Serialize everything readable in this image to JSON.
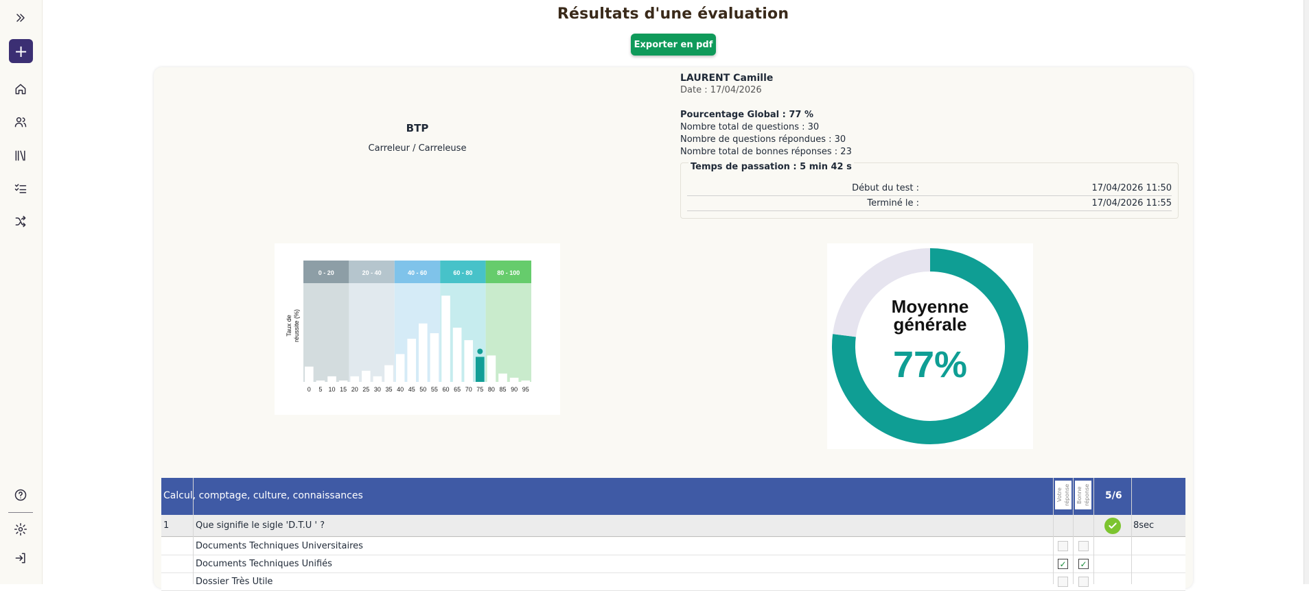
{
  "sidebar": {
    "items": [
      {
        "icon": "expand-chevrons-icon"
      },
      {
        "icon": "plus-icon"
      },
      {
        "icon": "home-icon"
      },
      {
        "icon": "users-icon"
      },
      {
        "icon": "library-icon"
      },
      {
        "icon": "checklist-icon"
      },
      {
        "icon": "shuffle-icon"
      },
      {
        "icon": "help-icon"
      },
      {
        "icon": "settings-icon"
      },
      {
        "icon": "logout-icon"
      }
    ]
  },
  "header": {
    "title": "Résultats d'une évaluation",
    "export_label": "Exporter en pdf"
  },
  "evaluation": {
    "domain": "BTP",
    "job": "Carreleur / Carreleuse"
  },
  "candidate": {
    "name": "LAURENT Camille",
    "date": "Date : 17/04/2026",
    "global_pct": "Pourcentage Global : 77 %",
    "total_questions": "Nombre total de questions : 30",
    "answered_questions": "Nombre de questions répondues : 30",
    "correct_answers": "Nombre total de bonnes réponses : 23"
  },
  "timing": {
    "title": "Temps de passation : 5 min 42 s",
    "start_label": "Début du test :",
    "start_value": "17/04/2026 11:50",
    "end_label": "Terminé le :",
    "end_value": "17/04/2026 11:55"
  },
  "chart_data": [
    {
      "type": "bar",
      "ylabel": "Taux de réussite (%)",
      "bands": [
        {
          "label": "0 - 20",
          "from": 0,
          "to": 20,
          "color": "#d3dcde",
          "head": "#8d9ea6"
        },
        {
          "label": "20 - 40",
          "from": 20,
          "to": 40,
          "color": "#e1e9ee",
          "head": "#b5c5cd"
        },
        {
          "label": "40 - 60",
          "from": 40,
          "to": 60,
          "color": "#d5ebf7",
          "head": "#7fc3ea"
        },
        {
          "label": "60 - 80",
          "from": 60,
          "to": 80,
          "color": "#c6ecee",
          "head": "#47c2c9"
        },
        {
          "label": "80 - 100",
          "from": 80,
          "to": 100,
          "color": "#c9ebcc",
          "head": "#66cc6c"
        }
      ],
      "categories": [
        "0",
        "5",
        "10",
        "15",
        "20",
        "25",
        "30",
        "35",
        "40",
        "45",
        "50",
        "55",
        "60",
        "65",
        "70",
        "75",
        "80",
        "85",
        "90",
        "95"
      ],
      "values": [
        11,
        1,
        4,
        1,
        4,
        8,
        4,
        12,
        20,
        31,
        42,
        35,
        62,
        39,
        30,
        18,
        19,
        6,
        3,
        1
      ],
      "ylim": [
        0,
        70
      ],
      "highlight_index": 15,
      "highlight_color": "#129e96"
    },
    {
      "type": "pie",
      "title": "Moyenne générale",
      "value_label": "77%",
      "values": [
        77,
        23
      ],
      "colors": [
        "#0f9e94",
        "#e6e4ef"
      ]
    }
  ],
  "table": {
    "category": "Calcul, comptage, culture, connaissances",
    "col_your": "Votre réponse",
    "col_good": "Bonne réponse",
    "score": "5/6",
    "question": {
      "num": "1",
      "text": "Que signifie le sigle 'D.T.U ' ?",
      "duration": "8sec"
    },
    "answers": [
      {
        "text": "Documents Techniques Universitaires",
        "yours": false,
        "good": false
      },
      {
        "text": "Documents Techniques Unifiés",
        "yours": true,
        "good": true
      },
      {
        "text": "Dossier Très Utile",
        "yours": false,
        "good": false
      }
    ]
  }
}
